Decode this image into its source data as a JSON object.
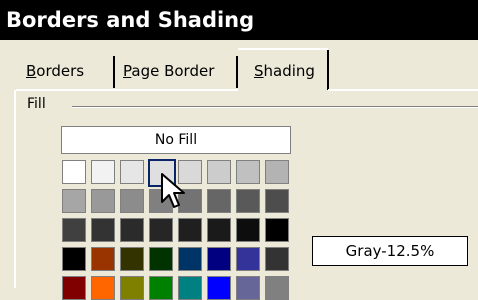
{
  "window": {
    "title": "Borders and Shading"
  },
  "tabs": [
    {
      "label": "Borders",
      "mnemonic": "B",
      "rest": "orders"
    },
    {
      "label": "Page Border",
      "mnemonic": "P",
      "rest": "age Border"
    },
    {
      "label": "Shading",
      "mnemonic": "S",
      "rest": "hading"
    }
  ],
  "fill": {
    "section_label": "Fill",
    "no_fill_label": "No Fill",
    "selected_color_name": "Gray-12.5%"
  },
  "palette": {
    "rows": [
      [
        "#ffffff",
        "#f2f2f2",
        "#e6e6e6",
        "#dfdfdf",
        "#d9d9d9",
        "#cccccc",
        "#c0c0c0",
        "#b3b3b3"
      ],
      [
        "#a6a6a6",
        "#999999",
        "#8c8c8c",
        "#808080",
        "#737373",
        "#666666",
        "#595959",
        "#4d4d4d"
      ],
      [
        "#404040",
        "#333333",
        "#2b2b2b",
        "#262626",
        "#1f1f1f",
        "#1a1a1a",
        "#0d0d0d",
        "#000000"
      ],
      [
        "#000000",
        "#993300",
        "#333300",
        "#003300",
        "#003366",
        "#000080",
        "#333399",
        "#333333"
      ],
      [
        "#800000",
        "#ff6600",
        "#808000",
        "#008000",
        "#008080",
        "#0000ff",
        "#666699",
        "#808080"
      ]
    ],
    "selected": {
      "row": 0,
      "col": 3
    }
  },
  "icons": {
    "cursor": "arrow-cursor-icon"
  }
}
